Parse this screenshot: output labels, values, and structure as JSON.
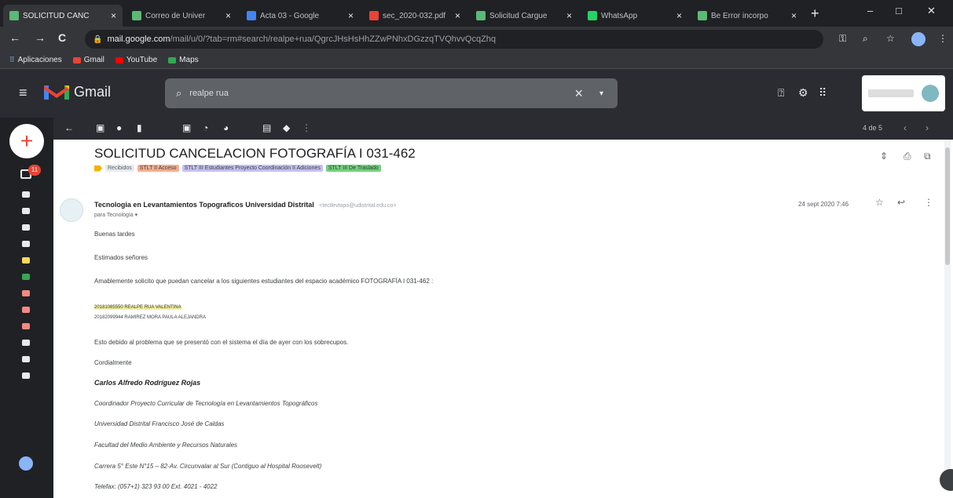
{
  "tabs": [
    {
      "title": "SOLICITUD CANC",
      "color": "#5bb974"
    },
    {
      "title": "Correo de Univer",
      "color": "#5bb974"
    },
    {
      "title": "Acta 03 - Google",
      "color": "#4285f4"
    },
    {
      "title": "sec_2020-032.pdf",
      "color": "#ea4335"
    },
    {
      "title": "Solicitud Cargue",
      "color": "#5bb974"
    },
    {
      "title": "WhatsApp",
      "color": "#25d366"
    },
    {
      "title": "Be Error incorpo",
      "color": "#5bb974"
    }
  ],
  "tab_close": "×",
  "new_tab": "+",
  "window_controls": {
    "minimize": "–",
    "maximize": "□",
    "close": "✕"
  },
  "nav": {
    "back": "←",
    "forward": "→",
    "reload": "C"
  },
  "address": {
    "domain": "mail.google.com",
    "path": "/mail/u/0/?tab=rm#search/realpe+rua/QgrcJHsHsHhZZwPNhxDGzzqTVQhvvQcqZhq"
  },
  "bookmarks": {
    "apps": "Aplicaciones",
    "items": [
      {
        "label": "Gmail",
        "color": "#ea4335"
      },
      {
        "label": "YouTube",
        "color": "#ff0000"
      },
      {
        "label": "Maps",
        "color": "#34a853"
      }
    ]
  },
  "gmail": {
    "brand": "Gmail",
    "search_query": "realpe rua",
    "search_clear": "×",
    "search_options": "▾"
  },
  "rail": {
    "compose": "+",
    "inbox_count": "11"
  },
  "pager": "4 de 5",
  "message": {
    "subject": "SOLICITUD CANCELACION FOTOGRAFÍA I 031-462",
    "labels": [
      {
        "text": "Recibidos",
        "bg": "#e8eaed",
        "fg": "#5f6368"
      },
      {
        "text": "STLT II Acceso",
        "bg": "#f6ae8f",
        "fg": "#3c4043"
      },
      {
        "text": "STLT III Estudiantes Proyecto Coordinación II Adiciones",
        "bg": "#c6c0f2",
        "fg": "#3c4043"
      },
      {
        "text": "STLT III De Traslado",
        "bg": "#75d07f",
        "fg": "#1e4620"
      }
    ],
    "sender_name": "Tecnologia en Levantamientos Topograficos Universidad Distrital",
    "sender_email": "<tectlevtopo@udistrital.edu.co>",
    "to": "para Tecnología ▾",
    "date": "24 sept 2020 7:46",
    "body": {
      "greeting": "Buenas tardes",
      "salutation": "Estimados señores",
      "request": "Amablemente solicito que puedan cancelar a los siguientes estudiantes del espacio académico FOTOGRAFÍA I 031-462 :",
      "student1": "20181085550 REALPE RUA VALENTINA",
      "student2": "20182099944 RAMIREZ MORA PAULA ALEJANDRA",
      "reason": "Esto debido al problema que se presentó con el sistema el día de ayer con los sobrecupos.",
      "closing": "Cordialmente",
      "sig_name": "Carlos Alfredo Rodríguez Rojas",
      "sig_title": "Coordinador Proyecto Curricular de Tecnología en Levantamientos Topográficos",
      "sig_university": "Universidad Distrital Francisco José de Caldas",
      "sig_faculty": "Facultad del Medio Ambiente y Recursos Naturales",
      "sig_address": "Carrera 5° Este N°15 – 82-Av. Circunvalar al Sur (Contiguo al Hospital Roosevelt)",
      "sig_phone": "Telefax: (057+1) 323 93 00 Ext. 4021 - 4022"
    }
  }
}
